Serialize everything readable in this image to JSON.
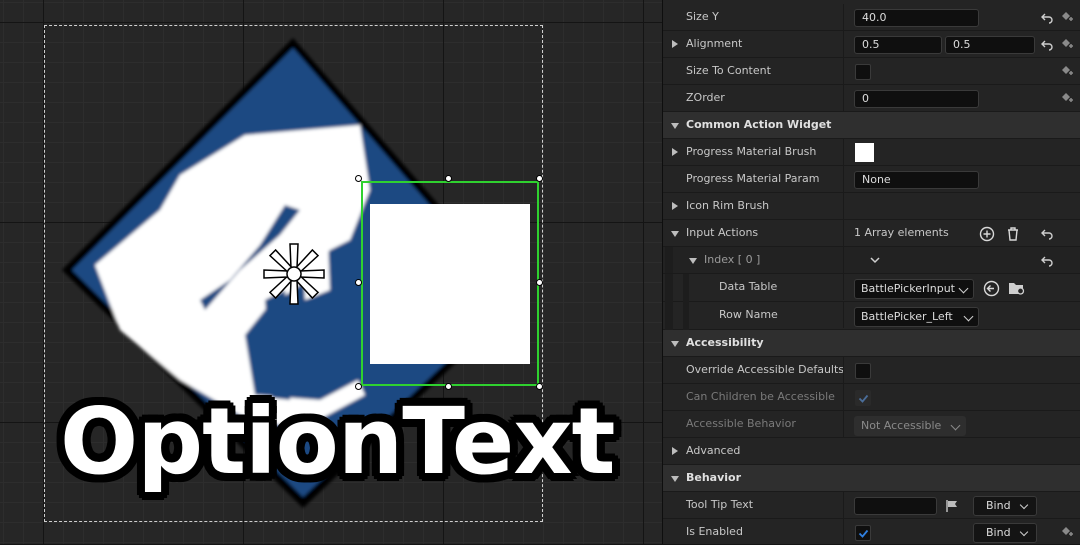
{
  "viewport": {
    "option_text": "OptionText",
    "icon": "crossed-swords-diamond-icon",
    "accent_color": "#2fd12f",
    "diamond_color": "#1f4982"
  },
  "details": {
    "size_y": {
      "label": "Size Y",
      "value": "40.0"
    },
    "alignment": {
      "label": "Alignment",
      "x": "0.5",
      "y": "0.5"
    },
    "size_to_content": {
      "label": "Size To Content",
      "checked": false
    },
    "zorder": {
      "label": "ZOrder",
      "value": "0"
    },
    "common_action_widget": {
      "title": "Common Action Widget",
      "progress_material_brush": {
        "label": "Progress Material Brush",
        "color": "#ffffff"
      },
      "progress_material_param": {
        "label": "Progress Material Param",
        "value": "None"
      },
      "icon_rim_brush": {
        "label": "Icon Rim Brush"
      },
      "input_actions": {
        "label": "Input Actions",
        "summary": "1 Array elements",
        "index": {
          "label": "Index [ 0 ]",
          "data_table": {
            "label": "Data Table",
            "value": "BattlePickerInput"
          },
          "row_name": {
            "label": "Row Name",
            "value": "BattlePicker_Left"
          }
        }
      }
    },
    "accessibility": {
      "title": "Accessibility",
      "override_defaults": {
        "label": "Override Accessible Defaults",
        "checked": false
      },
      "can_children": {
        "label": "Can Children be Accessible",
        "checked": true
      },
      "accessible_behavior": {
        "label": "Accessible Behavior",
        "value": "Not Accessible"
      }
    },
    "advanced": {
      "label": "Advanced"
    },
    "behavior": {
      "title": "Behavior",
      "tooltip": {
        "label": "Tool Tip Text",
        "value": "",
        "bind": "Bind"
      },
      "is_enabled": {
        "label": "Is Enabled",
        "checked": true,
        "bind": "Bind"
      }
    }
  }
}
